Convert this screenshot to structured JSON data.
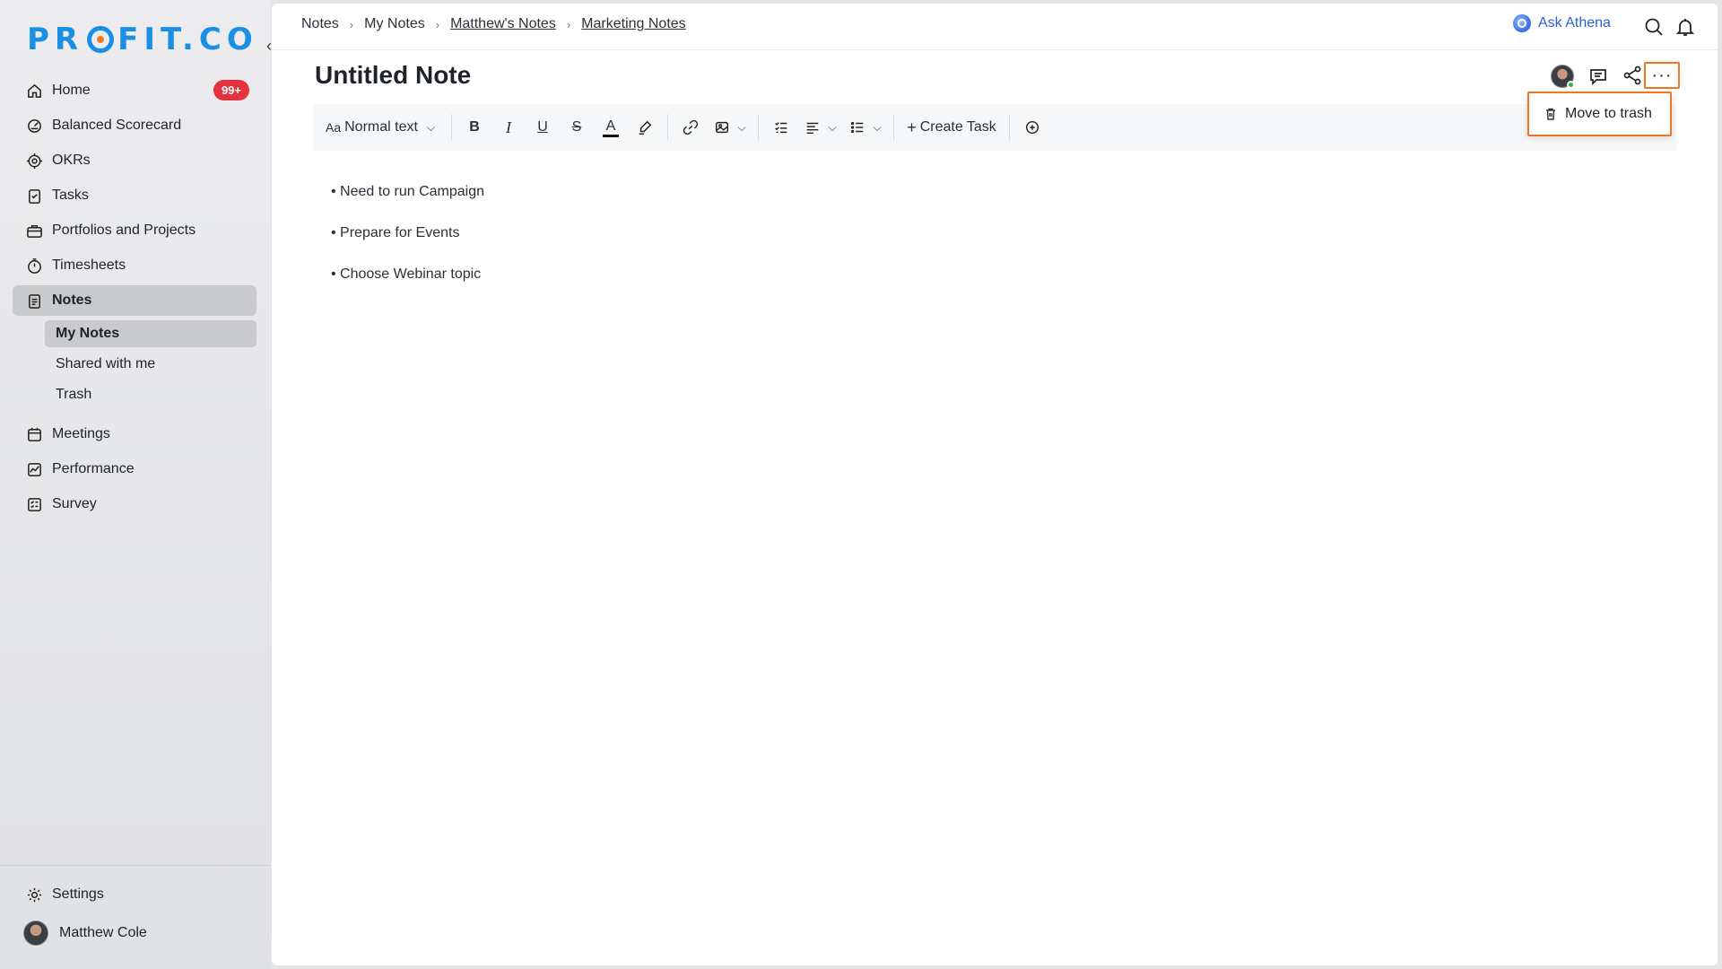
{
  "brand": {
    "logo_pre": "PR",
    "logo_post": "FIT.CO"
  },
  "sidebar": {
    "items": [
      {
        "label": "Home",
        "icon": "home-icon",
        "badge": "99+"
      },
      {
        "label": "Balanced Scorecard",
        "icon": "scorecard-icon"
      },
      {
        "label": "OKRs",
        "icon": "target-icon"
      },
      {
        "label": "Tasks",
        "icon": "clipboard-check-icon"
      },
      {
        "label": "Portfolios and Projects",
        "icon": "briefcase-icon"
      },
      {
        "label": "Timesheets",
        "icon": "stopwatch-icon"
      },
      {
        "label": "Notes",
        "icon": "notes-icon",
        "active": true
      },
      {
        "label": "Meetings",
        "icon": "calendar-icon"
      },
      {
        "label": "Performance",
        "icon": "chart-line-icon"
      },
      {
        "label": "Survey",
        "icon": "checklist-icon"
      }
    ],
    "notes_sub": [
      "My Notes",
      "Shared with me",
      "Trash"
    ],
    "settings_label": "Settings",
    "user_name": "Matthew Cole"
  },
  "breadcrumb": [
    "Notes",
    "My Notes",
    "Matthew's Notes",
    "Marketing Notes"
  ],
  "topbar": {
    "ask_athena": "Ask Athena"
  },
  "note": {
    "title": "Untitled Note",
    "lines": [
      "• Need to run Campaign",
      "• Prepare for Events",
      "• Choose Webinar topic"
    ]
  },
  "toolbar": {
    "text_style_prefix": "Aa",
    "text_style": "Normal text",
    "create_task": "Create Task"
  },
  "menu": {
    "move_to_trash": "Move to trash"
  },
  "colors": {
    "accent": "#1b8fe3",
    "highlight": "#f07423",
    "badge": "#e2333f",
    "athena": "#2d5fd3"
  }
}
